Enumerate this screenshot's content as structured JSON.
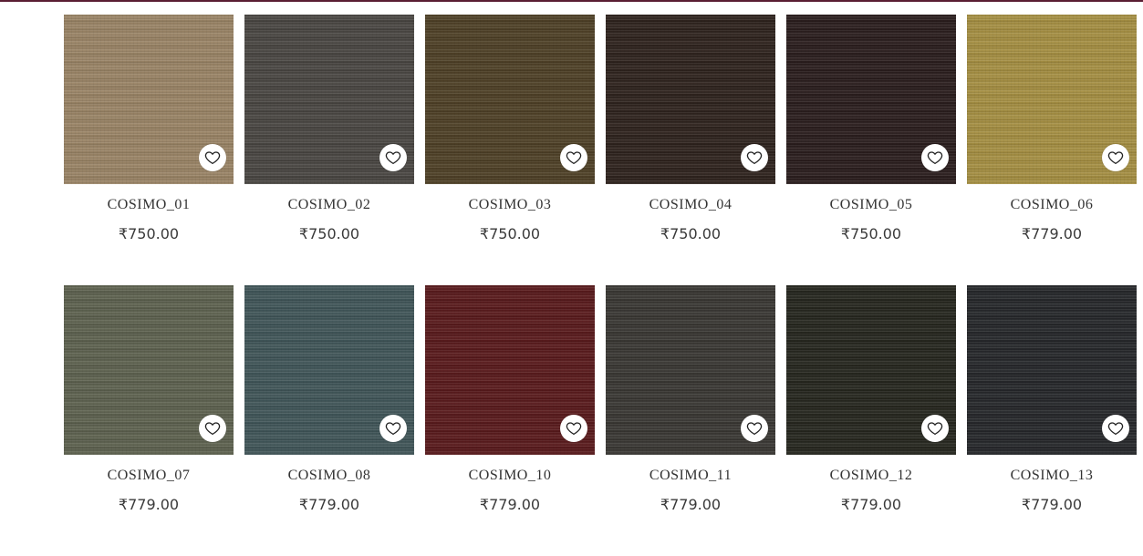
{
  "products": [
    {
      "name": "COSIMO_01",
      "price": "₹750.00",
      "color": "#9a8466"
    },
    {
      "name": "COSIMO_02",
      "price": "₹750.00",
      "color": "#4a4743"
    },
    {
      "name": "COSIMO_03",
      "price": "₹750.00",
      "color": "#4f4127"
    },
    {
      "name": "COSIMO_04",
      "price": "₹750.00",
      "color": "#2f231e"
    },
    {
      "name": "COSIMO_05",
      "price": "₹750.00",
      "color": "#2b1e1e"
    },
    {
      "name": "COSIMO_06",
      "price": "₹779.00",
      "color": "#a58f43"
    },
    {
      "name": "COSIMO_07",
      "price": "₹779.00",
      "color": "#5e6250"
    },
    {
      "name": "COSIMO_08",
      "price": "₹779.00",
      "color": "#415659"
    },
    {
      "name": "COSIMO_10",
      "price": "₹779.00",
      "color": "#5a1b1d"
    },
    {
      "name": "COSIMO_11",
      "price": "₹779.00",
      "color": "#3a3834"
    },
    {
      "name": "COSIMO_12",
      "price": "₹779.00",
      "color": "#26271f"
    },
    {
      "name": "COSIMO_13",
      "price": "₹779.00",
      "color": "#26282b"
    }
  ],
  "icons": {
    "wishlist": "heart-outline-icon"
  },
  "theme": {
    "top_bar_color": "#5a1e33"
  }
}
